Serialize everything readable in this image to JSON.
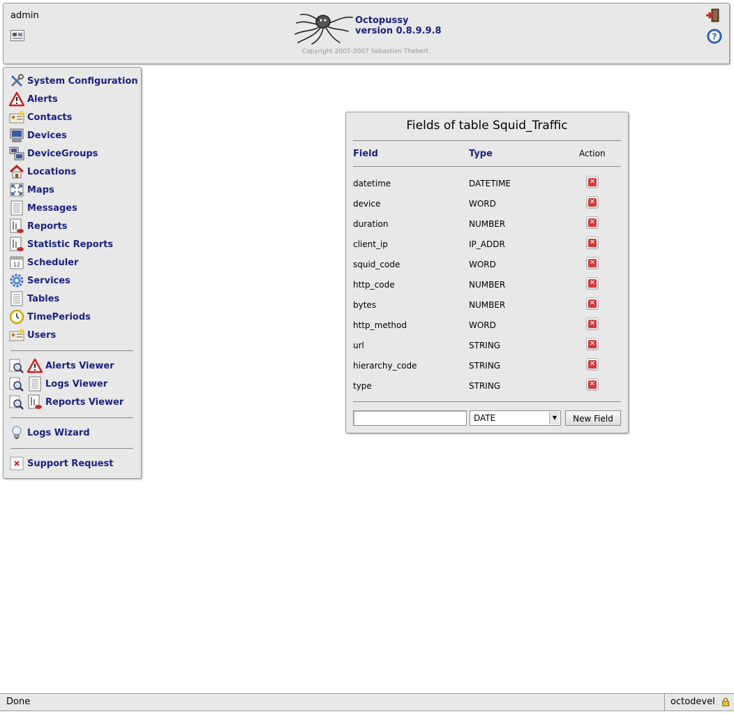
{
  "header": {
    "user": "admin",
    "app_name": "Octopussy",
    "version": "version 0.8.9.9.8",
    "copyright": "Copyright 2005-2007 Sebastien Thebert."
  },
  "menu": {
    "items": [
      {
        "label": "System Configuration",
        "icon": "tools-icon"
      },
      {
        "label": "Alerts",
        "icon": "alert-icon"
      },
      {
        "label": "Contacts",
        "icon": "contact-card-icon"
      },
      {
        "label": "Devices",
        "icon": "computer-icon"
      },
      {
        "label": "DeviceGroups",
        "icon": "device-group-icon"
      },
      {
        "label": "Locations",
        "icon": "house-icon"
      },
      {
        "label": "Maps",
        "icon": "maps-icon"
      },
      {
        "label": "Messages",
        "icon": "document-icon"
      },
      {
        "label": "Reports",
        "icon": "report-icon"
      },
      {
        "label": "Statistic Reports",
        "icon": "report-icon"
      },
      {
        "label": "Scheduler",
        "icon": "calendar-icon"
      },
      {
        "label": "Services",
        "icon": "gear-icon"
      },
      {
        "label": "Tables",
        "icon": "document-icon"
      },
      {
        "label": "TimePeriods",
        "icon": "clock-icon"
      },
      {
        "label": "Users",
        "icon": "contact-card-icon"
      }
    ],
    "viewers": [
      {
        "label": "Alerts Viewer"
      },
      {
        "label": "Logs Viewer"
      },
      {
        "label": "Reports Viewer"
      }
    ],
    "wizard": "Logs Wizard",
    "support": "Support Request"
  },
  "panel": {
    "title": "Fields of table Squid_Traffic",
    "col_field": "Field",
    "col_type": "Type",
    "col_action": "Action",
    "rows": [
      {
        "field": "datetime",
        "type": "DATETIME"
      },
      {
        "field": "device",
        "type": "WORD"
      },
      {
        "field": "duration",
        "type": "NUMBER"
      },
      {
        "field": "client_ip",
        "type": "IP_ADDR"
      },
      {
        "field": "squid_code",
        "type": "WORD"
      },
      {
        "field": "http_code",
        "type": "NUMBER"
      },
      {
        "field": "bytes",
        "type": "NUMBER"
      },
      {
        "field": "http_method",
        "type": "WORD"
      },
      {
        "field": "url",
        "type": "STRING"
      },
      {
        "field": "hierarchy_code",
        "type": "STRING"
      },
      {
        "field": "type",
        "type": "STRING"
      }
    ],
    "delete_glyph": "✕",
    "new_field_value": "",
    "new_type_selected": "DATE",
    "new_field_button": "New Field"
  },
  "statusbar": {
    "text": "Done",
    "host": "octodevel"
  }
}
